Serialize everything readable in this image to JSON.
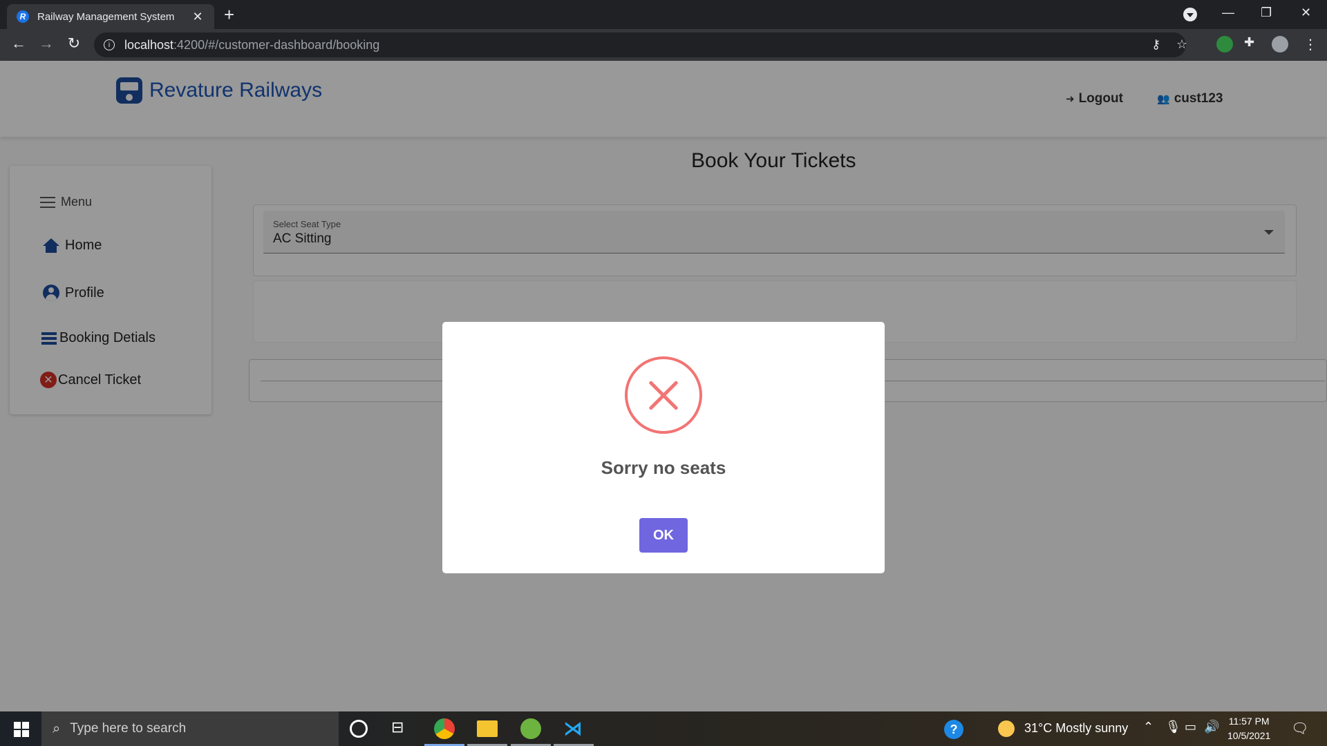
{
  "browser": {
    "tab_title": "Railway Management System",
    "tab_favicon_letter": "R",
    "url_host": "localhost",
    "url_path": ":4200/#/customer-dashboard/booking"
  },
  "header": {
    "brand": "Revature Railways",
    "logout_label": "Logout",
    "username": "cust123"
  },
  "sidebar": {
    "menu_label": "Menu",
    "items": [
      {
        "label": "Home",
        "icon": "home-icon"
      },
      {
        "label": "Profile",
        "icon": "profile-icon"
      },
      {
        "label": "Booking Detials",
        "icon": "list-icon"
      },
      {
        "label": "Cancel Ticket",
        "icon": "cancel-icon"
      }
    ]
  },
  "main": {
    "title": "Book Your Tickets",
    "seat_select": {
      "label": "Select Seat Type",
      "value": "AC Sitting"
    }
  },
  "dialog": {
    "icon": "error-icon",
    "message": "Sorry no seats",
    "ok_label": "OK",
    "colors": {
      "error": "#f27474",
      "confirm": "#7066e0"
    }
  },
  "taskbar": {
    "search_placeholder": "Type here to search",
    "weather": "31°C  Mostly sunny",
    "time": "11:57 PM",
    "date": "10/5/2021"
  }
}
